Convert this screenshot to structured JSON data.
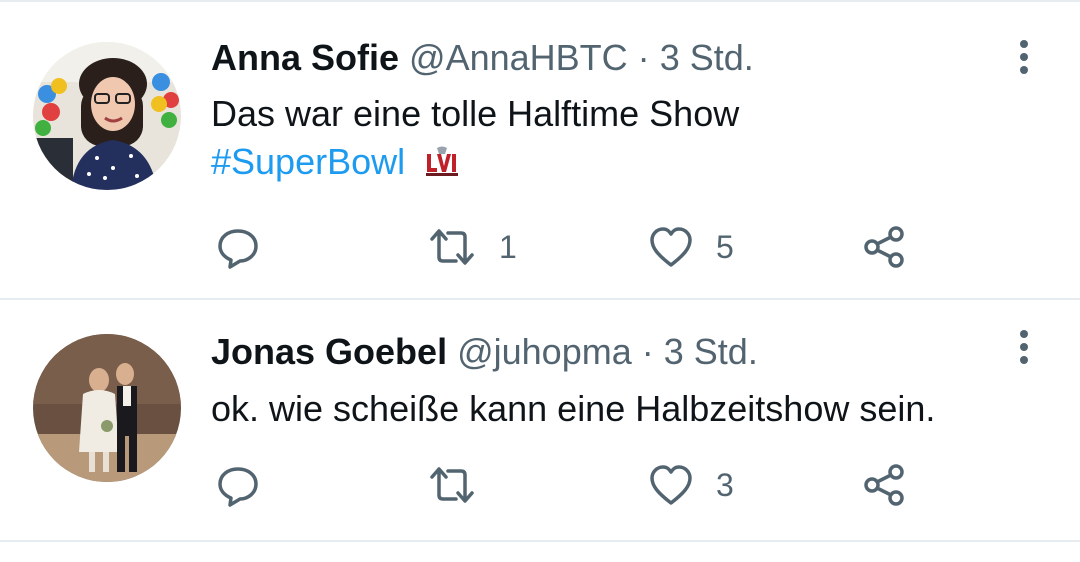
{
  "tweets": [
    {
      "name": "Anna Sofie",
      "handle": "@AnnaHBTC",
      "separator": "·",
      "time": "3 Std.",
      "text": "Das war eine tolle Halftime Show",
      "hashtag": "#SuperBowl",
      "hashtag_emoji": "super-bowl-lvi-logo",
      "actions": {
        "reply": "",
        "retweet": "1",
        "like": "5",
        "share": ""
      }
    },
    {
      "name": "Jonas Goebel",
      "handle": "@juhopma",
      "separator": "·",
      "time": "3 Std.",
      "text": "ok. wie scheiße kann eine Halbzeitshow sein.",
      "actions": {
        "reply": "",
        "retweet": "",
        "like": "3",
        "share": ""
      }
    }
  ],
  "colors": {
    "text": "#0f1419",
    "secondary": "#536471",
    "link": "#1d9bf0",
    "divider": "#e6ecf0"
  }
}
